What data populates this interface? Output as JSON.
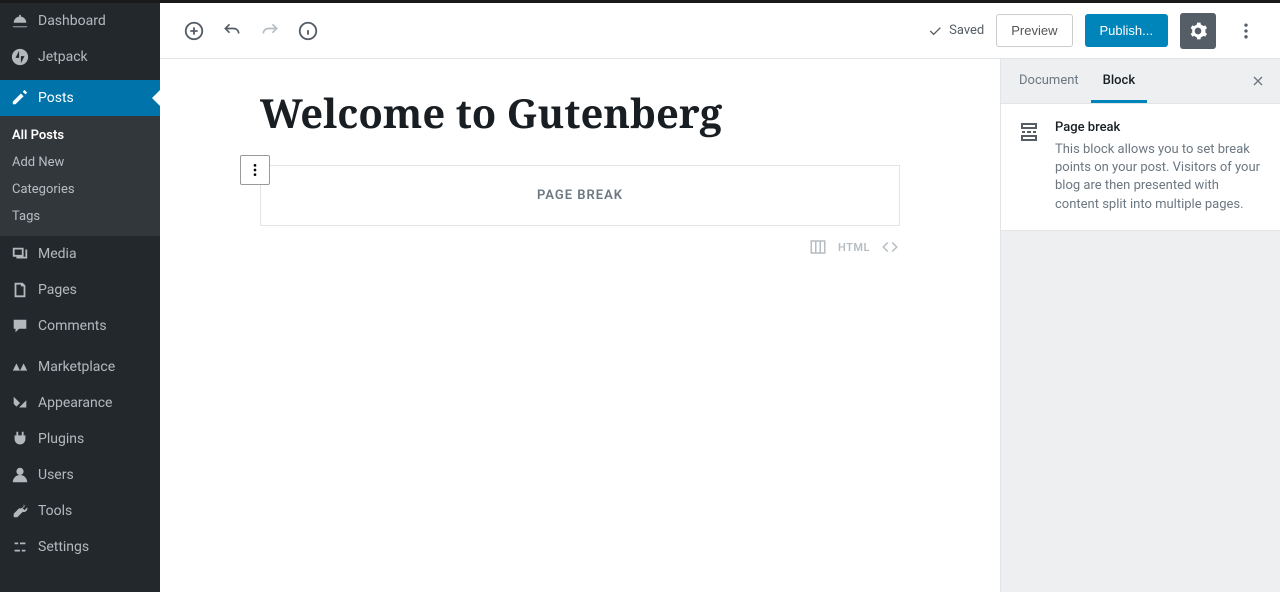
{
  "sidebar": {
    "dashboard": "Dashboard",
    "jetpack": "Jetpack",
    "posts": "Posts",
    "sub": {
      "all_posts": "All Posts",
      "add_new": "Add New",
      "categories": "Categories",
      "tags": "Tags"
    },
    "media": "Media",
    "pages": "Pages",
    "comments": "Comments",
    "marketplace": "Marketplace",
    "appearance": "Appearance",
    "plugins": "Plugins",
    "users": "Users",
    "tools": "Tools",
    "settings": "Settings"
  },
  "toolbar": {
    "saved": "Saved",
    "preview": "Preview",
    "publish": "Publish..."
  },
  "editor": {
    "title": "Welcome to Gutenberg",
    "page_break_label": "PAGE BREAK",
    "html_label": "HTML"
  },
  "inspector": {
    "tabs": {
      "document": "Document",
      "block": "Block"
    },
    "block": {
      "title": "Page break",
      "description": "This block allows you to set break points on your post. Visitors of your blog are then presented with content split into multiple pages."
    }
  }
}
